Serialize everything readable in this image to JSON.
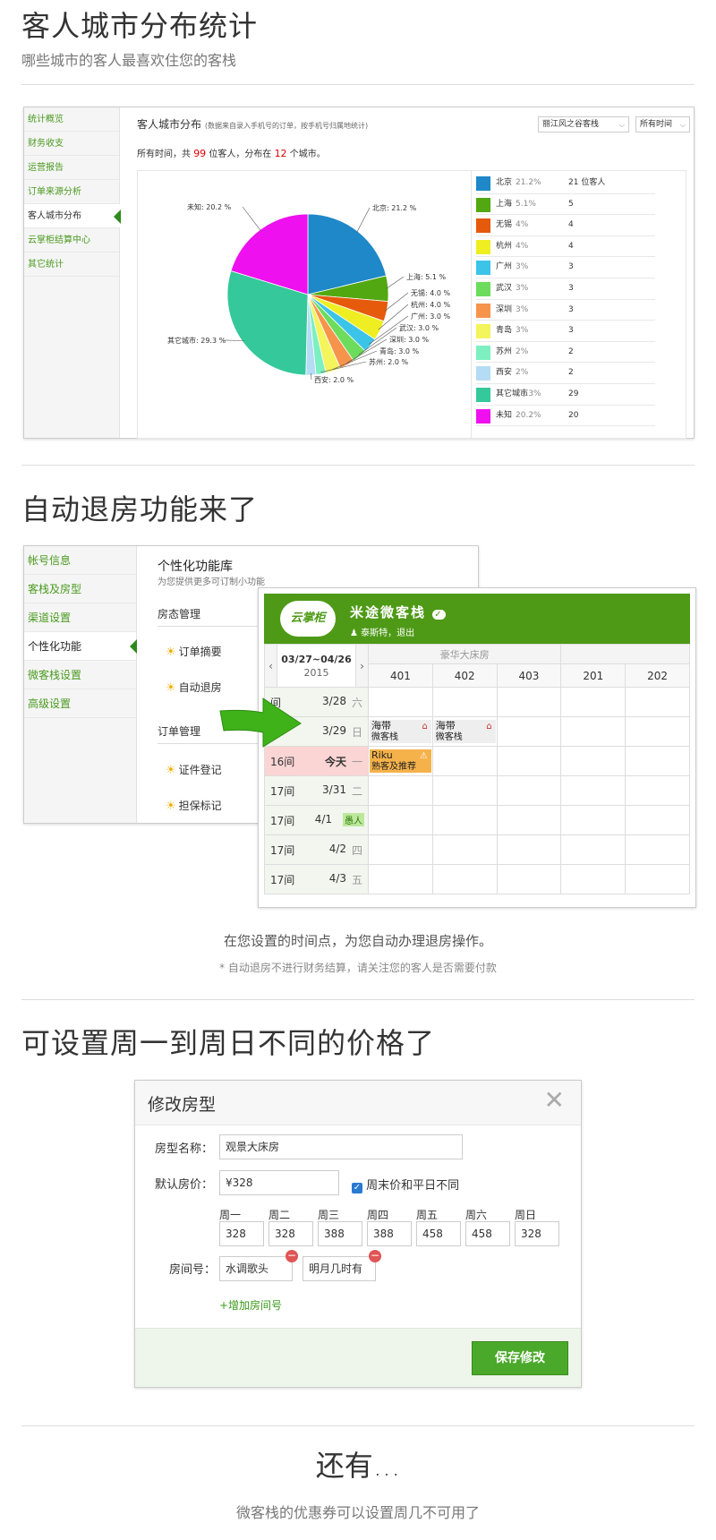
{
  "section1": {
    "title": "客人城市分布统计",
    "subtitle": "哪些城市的客人最喜欢住您的客栈",
    "nav": [
      "统计概览",
      "财务收支",
      "运营报告",
      "订单来源分析",
      "客人城市分布",
      "云掌柜结算中心",
      "其它统计"
    ],
    "panel_title": "客人城市分布",
    "panel_note": "(数据来自录入手机号的订单，按手机号归属地统计)",
    "select_inn": "丽江风之谷客栈",
    "select_time": "所有时间",
    "summary": {
      "prefix": "所有时间，共",
      "guests": "99",
      "mid": "位客人，分布在",
      "cities": "12",
      "suffix": "个城市。"
    }
  },
  "chart_data": {
    "type": "pie",
    "slices": [
      {
        "name": "北京",
        "pct": 21.2,
        "legend_pct": "21.2%",
        "count": "21 位客人",
        "label": "北京: 21.2 %",
        "color": "#1e88c8"
      },
      {
        "name": "上海",
        "pct": 5.1,
        "legend_pct": "5.1%",
        "count": "5",
        "label": "上海: 5.1 %",
        "color": "#52a810"
      },
      {
        "name": "无锡",
        "pct": 4.0,
        "legend_pct": "4%",
        "count": "4",
        "label": "无锡: 4.0 %",
        "color": "#e65a0c"
      },
      {
        "name": "杭州",
        "pct": 4.0,
        "legend_pct": "4%",
        "count": "4",
        "label": "杭州: 4.0 %",
        "color": "#eeee22"
      },
      {
        "name": "广州",
        "pct": 3.0,
        "legend_pct": "3%",
        "count": "3",
        "label": "广州: 3.0 %",
        "color": "#3cc4e8"
      },
      {
        "name": "武汉",
        "pct": 3.0,
        "legend_pct": "3%",
        "count": "3",
        "label": "武汉: 3.0 %",
        "color": "#6ddc5c"
      },
      {
        "name": "深圳",
        "pct": 3.0,
        "legend_pct": "3%",
        "count": "3",
        "label": "深圳: 3.0 %",
        "color": "#f6944c"
      },
      {
        "name": "青岛",
        "pct": 3.0,
        "legend_pct": "3%",
        "count": "3",
        "label": "青岛: 3.0 %",
        "color": "#f4f45c"
      },
      {
        "name": "苏州",
        "pct": 2.0,
        "legend_pct": "2%",
        "count": "2",
        "label": "苏州: 2.0 %",
        "color": "#7cf0c0"
      },
      {
        "name": "西安",
        "pct": 2.0,
        "legend_pct": "2%",
        "count": "2",
        "label": "西安: 2.0 %",
        "color": "#b4dcf4"
      },
      {
        "name": "其它城市",
        "pct": 29.3,
        "legend_pct": "29.3%",
        "count": "29",
        "label": "其它城市: 29.3 %",
        "color": "#34c89a"
      },
      {
        "name": "未知",
        "pct": 20.2,
        "legend_pct": "20.2%",
        "count": "20",
        "label": "未知: 20.2 %",
        "color": "#ee10ee"
      }
    ]
  },
  "section2": {
    "title": "自动退房功能来了",
    "nav": [
      "帐号信息",
      "客栈及房型",
      "渠道设置",
      "个性化功能",
      "微客栈设置",
      "高级设置"
    ],
    "lib_title": "个性化功能库",
    "lib_sub": "为您提供更多可订制小功能",
    "grp1": "房态管理",
    "items1": [
      "订单摘要",
      "自动退房"
    ],
    "grp2": "订单管理",
    "items2": [
      "证件登记",
      "担保标记"
    ],
    "cal": {
      "logo": "云掌柜",
      "inn_name": "米途微客栈",
      "user": "泰斯特，退出",
      "range": "03/27~04/26",
      "year": "2015",
      "room_type": "豪华大床房",
      "rooms": [
        "401",
        "402",
        "403",
        "201",
        "202"
      ],
      "rows": [
        {
          "left": "间",
          "date": "3/28",
          "wd": "六"
        },
        {
          "left": "间",
          "date": "3/29",
          "wd": "日"
        },
        {
          "left": "16间",
          "date": "今天",
          "wd": "一"
        },
        {
          "left": "17间",
          "date": "3/31",
          "wd": "二"
        },
        {
          "left": "17间",
          "date": "4/1",
          "wd": "愚人"
        },
        {
          "left": "17间",
          "date": "4/2",
          "wd": "四"
        },
        {
          "left": "17间",
          "date": "4/3",
          "wd": "五"
        }
      ],
      "booking1": {
        "name": "海带",
        "src": "微客栈"
      },
      "booking2": {
        "name": "海带",
        "src": "微客栈"
      },
      "booking3": {
        "name": "Riku",
        "src": "熟客及推荐"
      }
    },
    "caption": "在您设置的时间点，为您自动办理退房操作。",
    "note": "* 自动退房不进行财务结算，请关注您的客人是否需要付款"
  },
  "section3": {
    "title": "可设置周一到周日不同的价格了",
    "dialog_title": "修改房型",
    "name_label": "房型名称：",
    "name_value": "观景大床房",
    "price_label": "默认房价：",
    "currency": "¥",
    "price_value": "328",
    "weekend_label": "周末价和平日不同",
    "days": [
      {
        "d": "周一",
        "v": "328"
      },
      {
        "d": "周二",
        "v": "328"
      },
      {
        "d": "周三",
        "v": "388"
      },
      {
        "d": "周四",
        "v": "388"
      },
      {
        "d": "周五",
        "v": "458"
      },
      {
        "d": "周六",
        "v": "458"
      },
      {
        "d": "周日",
        "v": "328"
      }
    ],
    "room_label": "房间号：",
    "rooms": [
      "水调歌头",
      "明月几时有"
    ],
    "add_room": "+增加房间号",
    "save": "保存修改"
  },
  "section4": {
    "title": "还有...",
    "subtitle": "微客栈的优惠券可以设置周几不可用了"
  }
}
